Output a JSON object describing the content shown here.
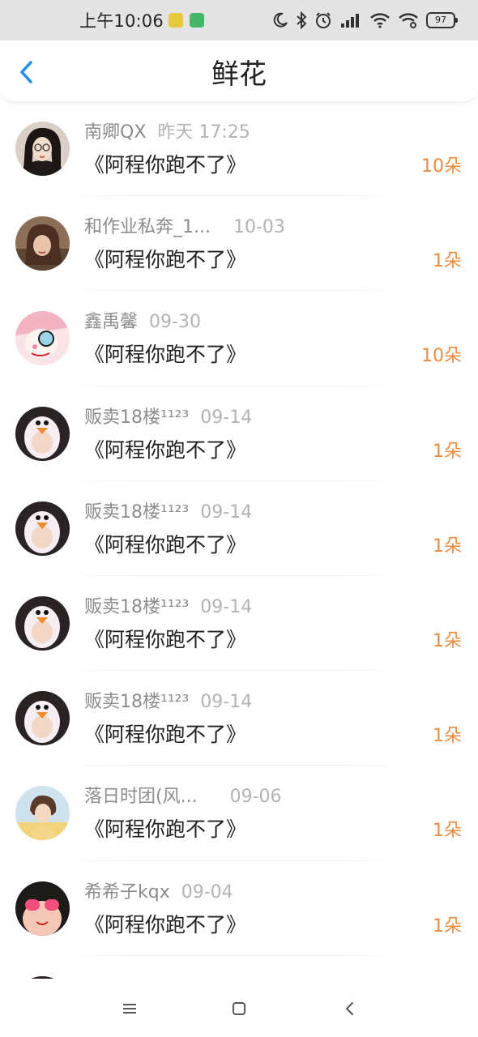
{
  "status_bar": {
    "time": "上午10:06",
    "battery": "97",
    "icons": [
      "weather-app-icon",
      "android-app-icon",
      "moon-icon",
      "bluetooth-icon",
      "alarm-icon",
      "signal-icon",
      "wifi-icon",
      "wifi-call-icon",
      "battery-icon"
    ]
  },
  "header": {
    "title": "鲜花",
    "back_icon": "chevron-left-icon"
  },
  "accent_color": "#1E8CF0",
  "count_color": "#F08B3C",
  "items": [
    {
      "nickname": "南卿QX",
      "date": "昨天 17:25",
      "title": "《阿程你跑不了》",
      "count": "10朵"
    },
    {
      "nickname": "和作业私奔_1...",
      "date": "10-03",
      "title": "《阿程你跑不了》",
      "count": "1朵"
    },
    {
      "nickname": "鑫禹馨",
      "date": "09-30",
      "title": "《阿程你跑不了》",
      "count": "10朵"
    },
    {
      "nickname": "贩卖18楼¹¹²³",
      "date": "09-14",
      "title": "《阿程你跑不了》",
      "count": "1朵"
    },
    {
      "nickname": "贩卖18楼¹¹²³",
      "date": "09-14",
      "title": "《阿程你跑不了》",
      "count": "1朵"
    },
    {
      "nickname": "贩卖18楼¹¹²³",
      "date": "09-14",
      "title": "《阿程你跑不了》",
      "count": "1朵"
    },
    {
      "nickname": "贩卖18楼¹¹²³",
      "date": "09-14",
      "title": "《阿程你跑不了》",
      "count": "1朵"
    },
    {
      "nickname": "落日时团(风...",
      "date": "09-06",
      "title": "《阿程你跑不了》",
      "count": "1朵"
    },
    {
      "nickname": "希希子kqx",
      "date": "09-04",
      "title": "《阿程你跑不了》",
      "count": "1朵"
    }
  ],
  "nav_bar": {
    "icons": [
      "menu-icon",
      "home-square-icon",
      "back-triangle-icon"
    ]
  }
}
